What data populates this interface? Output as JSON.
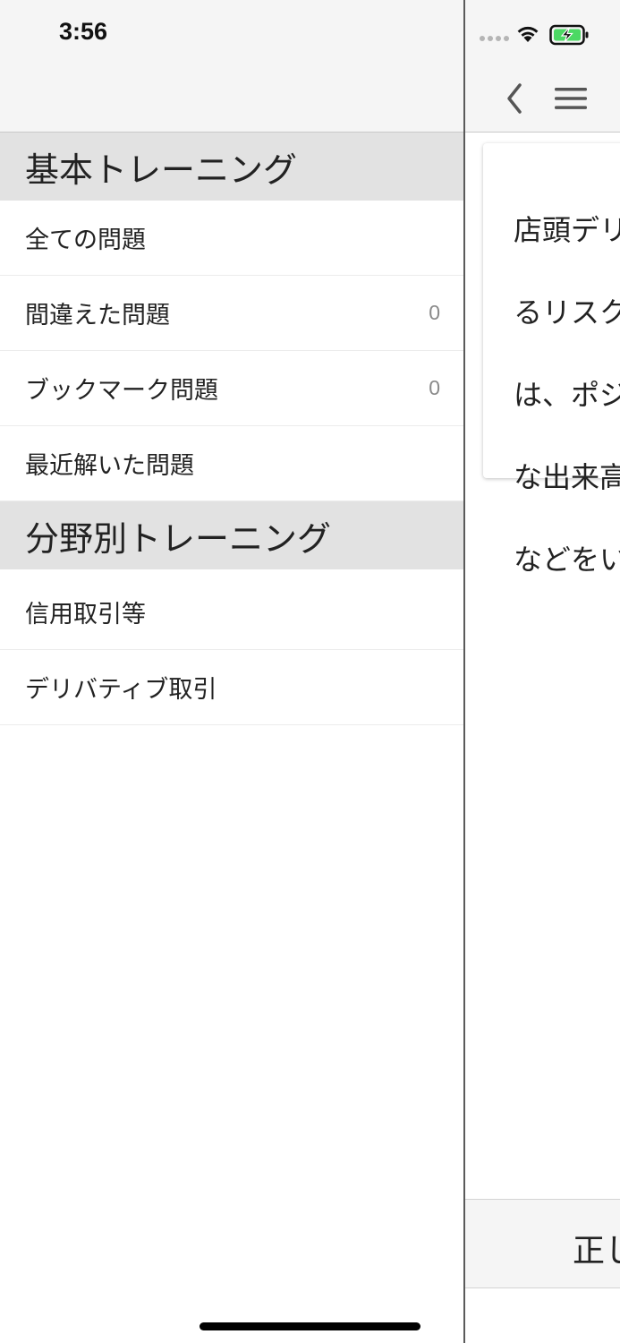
{
  "status_bar": {
    "time": "3:56"
  },
  "drawer": {
    "sections": [
      {
        "title": "基本トレーニング",
        "items": [
          {
            "label": "全ての問題",
            "count": null
          },
          {
            "label": "間違えた問題",
            "count": "0"
          },
          {
            "label": "ブックマーク問題",
            "count": "0"
          },
          {
            "label": "最近解いた問題",
            "count": null
          }
        ]
      },
      {
        "title": "分野別トレーニング",
        "items": [
          {
            "label": "信用取引等",
            "count": null
          },
          {
            "label": "デリバティブ取引",
            "count": null
          }
        ]
      }
    ]
  },
  "content": {
    "question_lines": [
      "店頭デリ",
      "るリスク",
      "は、ポジ",
      "な出来高",
      "などをい"
    ],
    "answer_label": "正し"
  },
  "colors": {
    "battery_green": "#4cd964",
    "section_header_bg": "#e2e2e2",
    "nav_bg": "#f5f5f5"
  },
  "icons": {
    "back": "chevron-left-icon",
    "menu": "hamburger-menu-icon",
    "wifi": "wifi-icon",
    "battery": "battery-charging-icon"
  }
}
